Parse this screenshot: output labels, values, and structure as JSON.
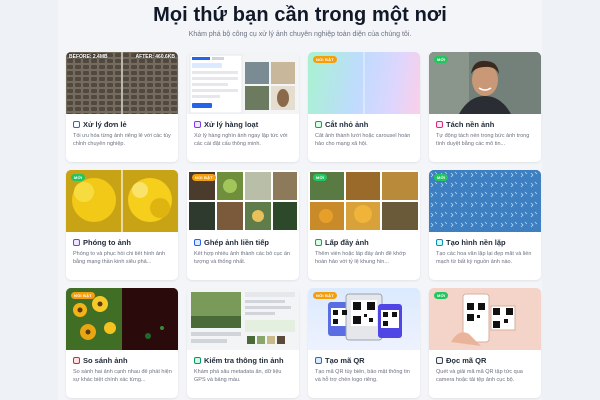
{
  "header": {
    "title": "Mọi thứ bạn cần trong một nơi",
    "subtitle": "Khám phá bộ công cụ xử lý ảnh chuyên nghiệp toàn diện của chúng tôi."
  },
  "badges": {
    "hot": "NỔI BẬT",
    "new": "MỚI"
  },
  "compare": {
    "before": "BEFORE: 2.4MB",
    "after": "AFTER: 460.6KB"
  },
  "cards": [
    {
      "title": "Xử lý đơn lẻ",
      "desc": "Tối ưu hóa từng ảnh riêng lẻ với các tùy chỉnh chuyên nghiệp.",
      "icon": "image-icon",
      "color": "#2563eb"
    },
    {
      "title": "Xử lý hàng loạt",
      "desc": "Xử lý hàng nghìn ảnh ngay lập tức với các cài đặt cấu thông minh.",
      "icon": "layers-icon",
      "color": "#7c3aed"
    },
    {
      "title": "Cắt nhỏ ảnh",
      "desc": "Cắt ảnh thành lưới hoặc carousel hoàn hảo cho mạng xã hội.",
      "icon": "scissors-icon",
      "color": "#16a34a"
    },
    {
      "title": "Tách nền ảnh",
      "desc": "Tự động tách nền trong bức ảnh trong tình duyệt bằng các mô tin...",
      "icon": "eraser-icon",
      "color": "#db2777"
    },
    {
      "title": "Phóng to ảnh",
      "desc": "Phóng to và phục hồi chi tiết hình ảnh bằng mạng thần kinh siêu phả...",
      "icon": "sparkle-icon",
      "color": "#7c3aed"
    },
    {
      "title": "Ghép ảnh liền tiếp",
      "desc": "Kết hợp nhiều ảnh thành các bố cục ấn tượng và thống nhất.",
      "icon": "grid-icon",
      "color": "#2563eb"
    },
    {
      "title": "Lấp đầy ảnh",
      "desc": "Thêm viền hoặc lấp đầy ảnh để khớp hoàn hảo với tỷ lệ khung hìn...",
      "icon": "fill-icon",
      "color": "#16a34a"
    },
    {
      "title": "Tạo hình nền lặp",
      "desc": "Tạo các hoa văn lặp lại đẹp mắt và liền mạch từ bất kỳ nguồn ảnh nào.",
      "icon": "pattern-icon",
      "color": "#0891b2"
    },
    {
      "title": "So sánh ảnh",
      "desc": "So sánh hai ảnh cạnh nhau để phát hiện sự khác biệt chính xác từng...",
      "icon": "compare-icon",
      "color": "#dc2626"
    },
    {
      "title": "Kiểm tra thông tin ảnh",
      "desc": "Khám phá sâu metadata ẩn, dữ liệu GPS và bảng màu.",
      "icon": "info-icon",
      "color": "#059669"
    },
    {
      "title": "Tạo mã QR",
      "desc": "Tạo mã QR tùy biến, bảo mật thông tin và hỗ trợ chèn logo riêng.",
      "icon": "qr-icon",
      "color": "#2563eb"
    },
    {
      "title": "Đọc mã QR",
      "desc": "Quét và giải mã mã QR tập tức qua camera hoặc tải tệp ảnh cục bộ.",
      "icon": "scan-icon",
      "color": "#374151"
    }
  ]
}
